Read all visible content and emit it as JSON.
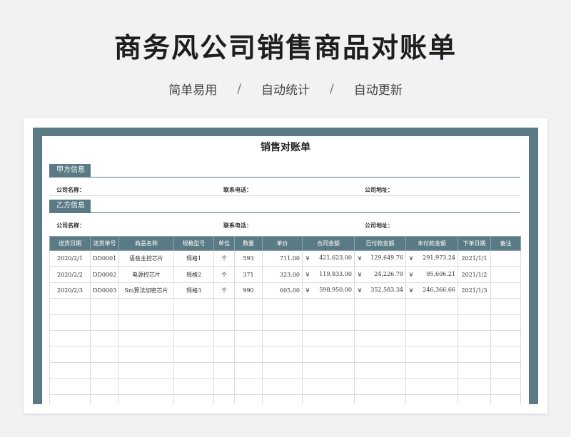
{
  "page": {
    "title": "商务风公司销售商品对账单",
    "subtitle": [
      "简单易用",
      "自动统计",
      "自动更新"
    ],
    "separator": "/"
  },
  "sheet": {
    "title": "销售对账单",
    "party_a": {
      "label": "甲方信息",
      "company_name": "公司名称：",
      "phone": "联系电话：",
      "address": "公司地址："
    },
    "party_b": {
      "label": "乙方信息",
      "company_name": "公司名称：",
      "phone": "联系电话：",
      "address": "公司地址："
    },
    "columns": [
      "送货日期",
      "送货单号",
      "商品名称",
      "规格型号",
      "单位",
      "数量",
      "单价",
      "合同金额",
      "已付款金额",
      "未付款金额",
      "下单日期",
      "备注"
    ],
    "currency_symbol": "￥",
    "rows": [
      {
        "date": "2020/2/1",
        "no": "DD0001",
        "name": "语音主控芯片",
        "spec": "规格1",
        "unit": "个",
        "qty": "593",
        "price": "711.00",
        "contract": "421,623.00",
        "paid": "129,649.76",
        "unpaid": "291,973.24",
        "order_date": "2021/1/1",
        "note": ""
      },
      {
        "date": "2020/2/2",
        "no": "DD0002",
        "name": "电源控芯片",
        "spec": "规格2",
        "unit": "个",
        "qty": "371",
        "price": "323.00",
        "contract": "119,833.00",
        "paid": "24,226.79",
        "unpaid": "95,606.21",
        "order_date": "2021/1/2",
        "note": ""
      },
      {
        "date": "2020/2/3",
        "no": "DD0003",
        "name": "Sm算法加密芯片",
        "spec": "规格3",
        "unit": "个",
        "qty": "990",
        "price": "605.00",
        "contract": "598,950.00",
        "paid": "352,583.34",
        "unpaid": "246,366.66",
        "order_date": "2021/1/3",
        "note": ""
      }
    ],
    "empty_rows": 8
  },
  "colors": {
    "accent": "#5a7b86",
    "background": "#f1f2f4"
  }
}
